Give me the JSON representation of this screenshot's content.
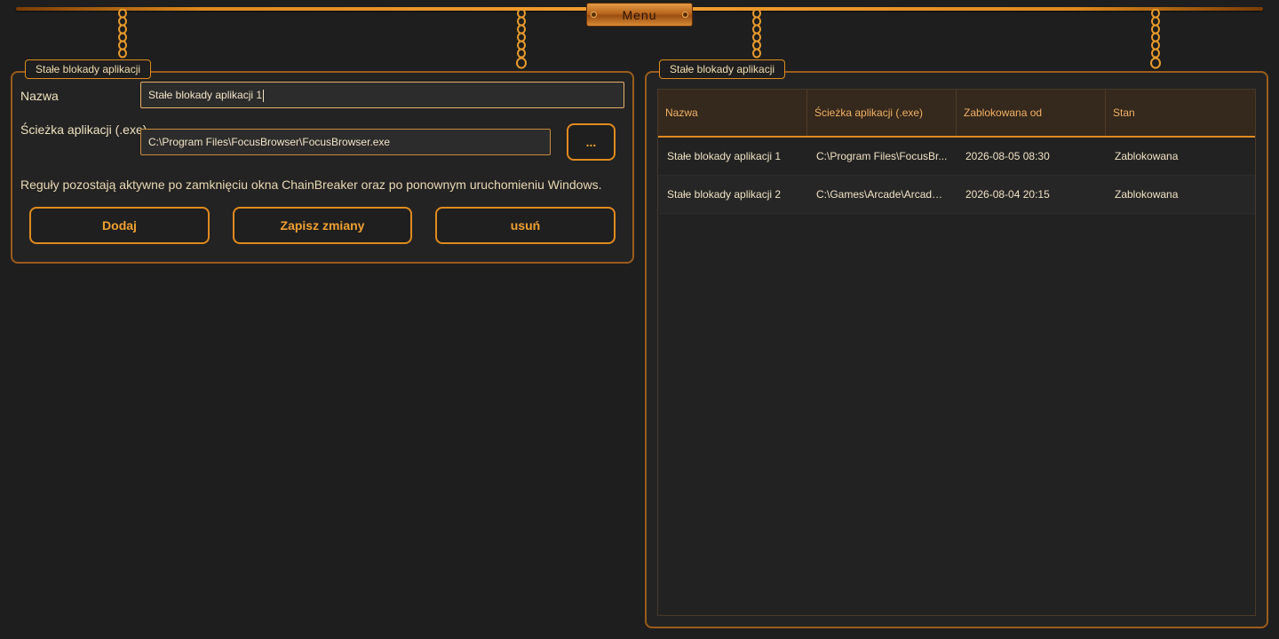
{
  "topbar": {
    "menu_label": "Menu"
  },
  "left_panel": {
    "title": "Stałe blokady aplikacji",
    "name_label": "Nazwa",
    "name_value": "Stałe blokady aplikacji 1",
    "path_label": "Ścieżka aplikacji (.exe)",
    "path_value": "C:\\Program Files\\FocusBrowser\\FocusBrowser.exe",
    "browse_label": "...",
    "note": "Reguły pozostają aktywne po zamknięciu okna ChainBreaker oraz po ponownym uruchomieniu Windows.",
    "buttons": {
      "add": "Dodaj",
      "save": "Zapisz zmiany",
      "delete": "usuń"
    }
  },
  "right_panel": {
    "title": "Stałe blokady aplikacji",
    "columns": [
      "Nazwa",
      "Ścieżka aplikacji (.exe)",
      "Zablokowana od",
      "Stan"
    ],
    "rows": [
      [
        "Stałe blokady aplikacji 1",
        "C:\\Program Files\\FocusBr...",
        "2026-08-05 08:30",
        "Zablokowana"
      ],
      [
        "Stałe blokady aplikacji 2",
        "C:\\Games\\Arcade\\Arcade....",
        "2026-08-04 20:15",
        "Zablokowana"
      ]
    ]
  },
  "colors": {
    "accent": "#e08a1e",
    "background": "#1e1e1e",
    "panel": "#232323",
    "header": "#35281c"
  }
}
